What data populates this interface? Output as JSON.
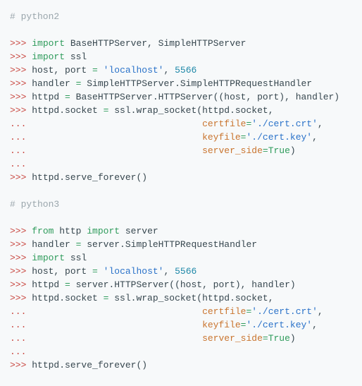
{
  "code": {
    "lines": [
      {
        "cls": "line",
        "tokens": [
          {
            "cls": "c-comment",
            "t": "# python2"
          }
        ]
      },
      {
        "blank": true
      },
      {
        "cls": "line",
        "tokens": [
          {
            "cls": "c-prompt",
            "t": ">>> "
          },
          {
            "cls": "c-keyword",
            "t": "import"
          },
          {
            "cls": "c-default",
            "t": " BaseHTTPServer, SimpleHTTPServer"
          }
        ]
      },
      {
        "cls": "line",
        "tokens": [
          {
            "cls": "c-prompt",
            "t": ">>> "
          },
          {
            "cls": "c-keyword",
            "t": "import"
          },
          {
            "cls": "c-default",
            "t": " ssl"
          }
        ]
      },
      {
        "cls": "line",
        "tokens": [
          {
            "cls": "c-prompt",
            "t": ">>> "
          },
          {
            "cls": "c-default",
            "t": "host, port "
          },
          {
            "cls": "c-keyword",
            "t": "="
          },
          {
            "cls": "c-default",
            "t": " "
          },
          {
            "cls": "c-string",
            "t": "'localhost'"
          },
          {
            "cls": "c-default",
            "t": ", "
          },
          {
            "cls": "c-number",
            "t": "5566"
          }
        ]
      },
      {
        "cls": "line",
        "tokens": [
          {
            "cls": "c-prompt",
            "t": ">>> "
          },
          {
            "cls": "c-default",
            "t": "handler "
          },
          {
            "cls": "c-keyword",
            "t": "="
          },
          {
            "cls": "c-default",
            "t": " SimpleHTTPServer.SimpleHTTPRequestHandler"
          }
        ]
      },
      {
        "cls": "line",
        "tokens": [
          {
            "cls": "c-prompt",
            "t": ">>> "
          },
          {
            "cls": "c-default",
            "t": "httpd "
          },
          {
            "cls": "c-keyword",
            "t": "="
          },
          {
            "cls": "c-default",
            "t": " BaseHTTPServer.HTTPServer((host, port), handler)"
          }
        ]
      },
      {
        "cls": "line",
        "tokens": [
          {
            "cls": "c-prompt",
            "t": ">>> "
          },
          {
            "cls": "c-default",
            "t": "httpd.socket "
          },
          {
            "cls": "c-keyword",
            "t": "="
          },
          {
            "cls": "c-default",
            "t": " ssl.wrap_socket(httpd.socket,"
          }
        ]
      },
      {
        "cls": "line",
        "tokens": [
          {
            "cls": "c-prompt",
            "t": "... "
          },
          {
            "cls": "c-default",
            "t": "                               "
          },
          {
            "cls": "c-kwarg",
            "t": "certfile"
          },
          {
            "cls": "c-keyword",
            "t": "="
          },
          {
            "cls": "c-string",
            "t": "'./cert.crt'"
          },
          {
            "cls": "c-default",
            "t": ","
          }
        ]
      },
      {
        "cls": "line",
        "tokens": [
          {
            "cls": "c-prompt",
            "t": "... "
          },
          {
            "cls": "c-default",
            "t": "                               "
          },
          {
            "cls": "c-kwarg",
            "t": "keyfile"
          },
          {
            "cls": "c-keyword",
            "t": "="
          },
          {
            "cls": "c-string",
            "t": "'./cert.key'"
          },
          {
            "cls": "c-default",
            "t": ","
          }
        ]
      },
      {
        "cls": "line",
        "tokens": [
          {
            "cls": "c-prompt",
            "t": "... "
          },
          {
            "cls": "c-default",
            "t": "                               "
          },
          {
            "cls": "c-kwarg",
            "t": "server_side"
          },
          {
            "cls": "c-keyword",
            "t": "="
          },
          {
            "cls": "c-keyword",
            "t": "True"
          },
          {
            "cls": "c-default",
            "t": ")"
          }
        ]
      },
      {
        "cls": "line",
        "tokens": [
          {
            "cls": "c-prompt",
            "t": "..."
          }
        ]
      },
      {
        "cls": "line",
        "tokens": [
          {
            "cls": "c-prompt",
            "t": ">>> "
          },
          {
            "cls": "c-default",
            "t": "httpd.serve_forever()"
          }
        ]
      },
      {
        "blank": true
      },
      {
        "cls": "line",
        "tokens": [
          {
            "cls": "c-comment",
            "t": "# python3"
          }
        ]
      },
      {
        "blank": true
      },
      {
        "cls": "line",
        "tokens": [
          {
            "cls": "c-prompt",
            "t": ">>> "
          },
          {
            "cls": "c-keyword",
            "t": "from"
          },
          {
            "cls": "c-default",
            "t": " http "
          },
          {
            "cls": "c-keyword",
            "t": "import"
          },
          {
            "cls": "c-default",
            "t": " server"
          }
        ]
      },
      {
        "cls": "line",
        "tokens": [
          {
            "cls": "c-prompt",
            "t": ">>> "
          },
          {
            "cls": "c-default",
            "t": "handler "
          },
          {
            "cls": "c-keyword",
            "t": "="
          },
          {
            "cls": "c-default",
            "t": " server.SimpleHTTPRequestHandler"
          }
        ]
      },
      {
        "cls": "line",
        "tokens": [
          {
            "cls": "c-prompt",
            "t": ">>> "
          },
          {
            "cls": "c-keyword",
            "t": "import"
          },
          {
            "cls": "c-default",
            "t": " ssl"
          }
        ]
      },
      {
        "cls": "line",
        "tokens": [
          {
            "cls": "c-prompt",
            "t": ">>> "
          },
          {
            "cls": "c-default",
            "t": "host, port "
          },
          {
            "cls": "c-keyword",
            "t": "="
          },
          {
            "cls": "c-default",
            "t": " "
          },
          {
            "cls": "c-string",
            "t": "'localhost'"
          },
          {
            "cls": "c-default",
            "t": ", "
          },
          {
            "cls": "c-number",
            "t": "5566"
          }
        ]
      },
      {
        "cls": "line",
        "tokens": [
          {
            "cls": "c-prompt",
            "t": ">>> "
          },
          {
            "cls": "c-default",
            "t": "httpd "
          },
          {
            "cls": "c-keyword",
            "t": "="
          },
          {
            "cls": "c-default",
            "t": " server.HTTPServer((host, port), handler)"
          }
        ]
      },
      {
        "cls": "line",
        "tokens": [
          {
            "cls": "c-prompt",
            "t": ">>> "
          },
          {
            "cls": "c-default",
            "t": "httpd.socket "
          },
          {
            "cls": "c-keyword",
            "t": "="
          },
          {
            "cls": "c-default",
            "t": " ssl.wrap_socket(httpd.socket,"
          }
        ]
      },
      {
        "cls": "line",
        "tokens": [
          {
            "cls": "c-prompt",
            "t": "... "
          },
          {
            "cls": "c-default",
            "t": "                               "
          },
          {
            "cls": "c-kwarg",
            "t": "certfile"
          },
          {
            "cls": "c-keyword",
            "t": "="
          },
          {
            "cls": "c-string",
            "t": "'./cert.crt'"
          },
          {
            "cls": "c-default",
            "t": ","
          }
        ]
      },
      {
        "cls": "line",
        "tokens": [
          {
            "cls": "c-prompt",
            "t": "... "
          },
          {
            "cls": "c-default",
            "t": "                               "
          },
          {
            "cls": "c-kwarg",
            "t": "keyfile"
          },
          {
            "cls": "c-keyword",
            "t": "="
          },
          {
            "cls": "c-string",
            "t": "'./cert.key'"
          },
          {
            "cls": "c-default",
            "t": ","
          }
        ]
      },
      {
        "cls": "line",
        "tokens": [
          {
            "cls": "c-prompt",
            "t": "... "
          },
          {
            "cls": "c-default",
            "t": "                               "
          },
          {
            "cls": "c-kwarg",
            "t": "server_side"
          },
          {
            "cls": "c-keyword",
            "t": "="
          },
          {
            "cls": "c-keyword",
            "t": "True"
          },
          {
            "cls": "c-default",
            "t": ")"
          }
        ]
      },
      {
        "cls": "line",
        "tokens": [
          {
            "cls": "c-prompt",
            "t": "..."
          }
        ]
      },
      {
        "cls": "line",
        "tokens": [
          {
            "cls": "c-prompt",
            "t": ">>> "
          },
          {
            "cls": "c-default",
            "t": "httpd.serve_forever()"
          }
        ]
      }
    ]
  }
}
